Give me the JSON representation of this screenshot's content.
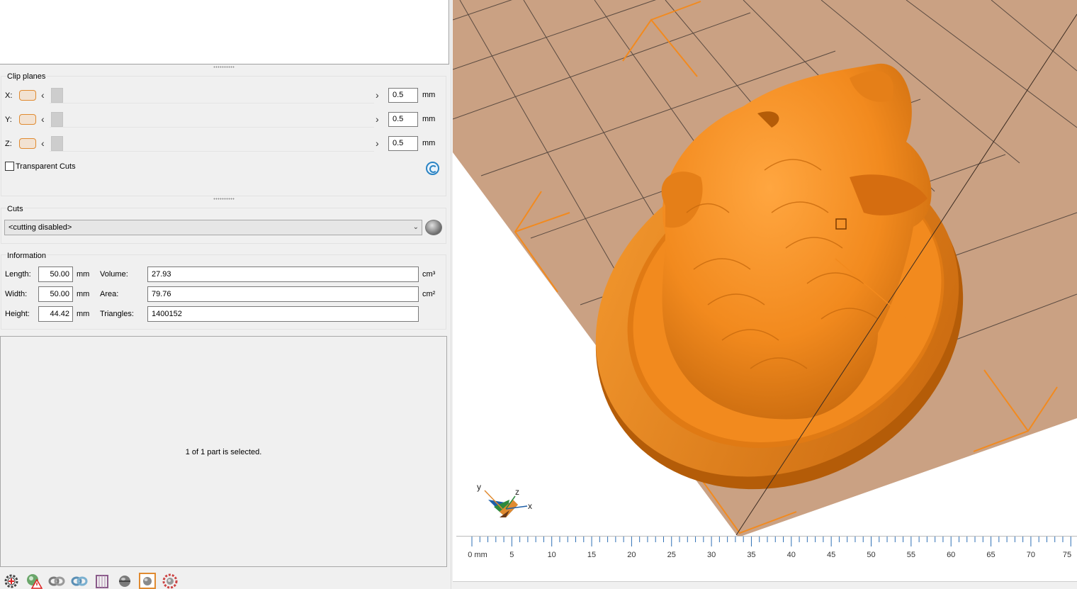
{
  "clip_planes": {
    "title": "Clip planes",
    "unit": "mm",
    "axes": [
      {
        "label": "X:",
        "value": "0.5"
      },
      {
        "label": "Y:",
        "value": "0.5"
      },
      {
        "label": "Z:",
        "value": "0.5"
      }
    ],
    "transparent_cuts_label": "Transparent Cuts",
    "transparent_cuts_checked": false
  },
  "cuts": {
    "title": "Cuts",
    "selected": "<cutting disabled>"
  },
  "information": {
    "title": "Information",
    "length_label": "Length:",
    "length_value": "50.00",
    "length_unit": "mm",
    "width_label": "Width:",
    "width_value": "50.00",
    "width_unit": "mm",
    "height_label": "Height:",
    "height_value": "44.42",
    "height_unit": "mm",
    "volume_label": "Volume:",
    "volume_value": "27.93",
    "volume_unit": "cm³",
    "area_label": "Area:",
    "area_value": "79.76",
    "area_unit": "cm²",
    "triangles_label": "Triangles:",
    "triangles_value": "1400152"
  },
  "status": {
    "selection_text": "1 of 1 part is selected."
  },
  "ruler": {
    "ticks": [
      "0 mm",
      "5",
      "10",
      "15",
      "20",
      "25",
      "30",
      "35",
      "40",
      "45",
      "50",
      "55",
      "60",
      "65",
      "70",
      "75"
    ]
  },
  "orientation": {
    "x": "x",
    "y": "y",
    "z": "z"
  },
  "colors": {
    "model_orange": "#f28a1e",
    "platform_tan": "#caa183",
    "grid_line": "#5a4a40"
  },
  "toolbar_icons": [
    "gear-add-icon",
    "warning-sphere-icon",
    "link-gray-icon",
    "link-blue-icon",
    "cube-frame-icon",
    "sphere-gray-icon",
    "square-frame-icon",
    "gear-red-icon"
  ]
}
